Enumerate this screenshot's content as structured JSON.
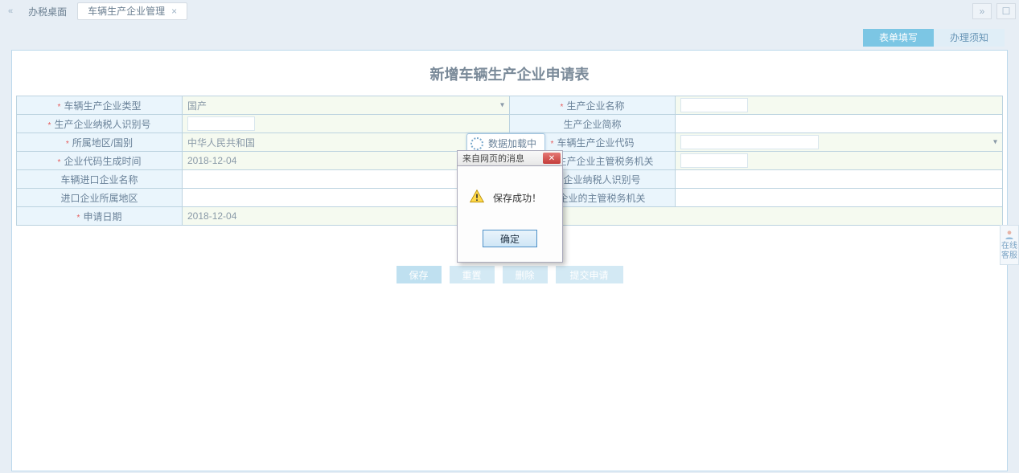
{
  "tabs": {
    "left_chev": "«",
    "main": "办税桌面",
    "active": "车辆生产企业管理",
    "right_chev": "»",
    "max": "☐"
  },
  "pill_tabs": {
    "fill": "表单填写",
    "notice": "办理须知"
  },
  "panel_title": "新增车辆生产企业申请表",
  "form": {
    "r1": {
      "l1": "车辆生产企业类型",
      "v1": "国产",
      "l2": "生产企业名称"
    },
    "r2": {
      "l1": "生产企业纳税人识别号",
      "l2": "生产企业简称"
    },
    "r3": {
      "l1": "所属地区/国别",
      "v1": "中华人民共和国",
      "l2": "车辆生产企业代码"
    },
    "r4": {
      "l1": "企业代码生成时间",
      "v1": "2018-12-04",
      "l2": "车辆生产企业主管税务机关"
    },
    "r5": {
      "l1": "车辆进口企业名称",
      "l2": "进口企业纳税人识别号"
    },
    "r6": {
      "l1": "进口企业所属地区",
      "l2": "进口企业的主管税务机关"
    },
    "r7": {
      "l1": "申请日期",
      "v1": "2018-12-04"
    }
  },
  "buttons": {
    "save": "保存",
    "reset": "重置",
    "del": "删除",
    "submit": "提交申请"
  },
  "loading": "数据加载中",
  "dialog": {
    "title": "来自网页的消息",
    "msg": "保存成功！",
    "ok": "确定"
  },
  "helper": "在线客服"
}
